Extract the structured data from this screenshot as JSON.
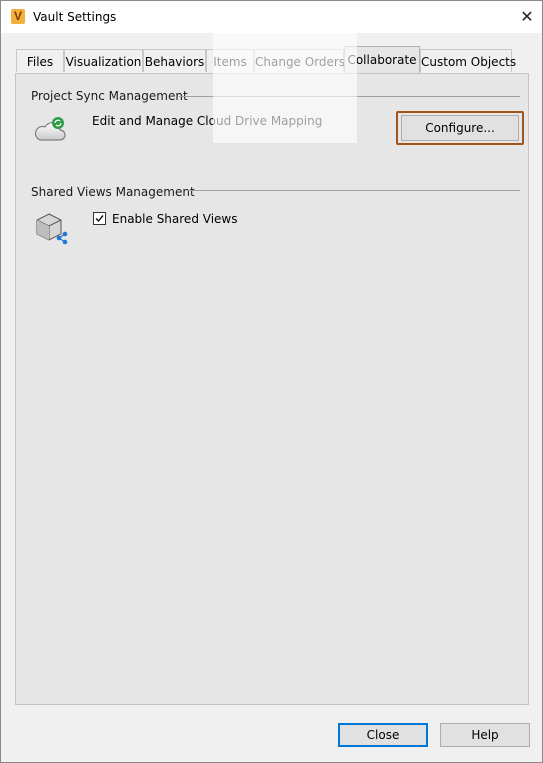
{
  "window": {
    "title": "Vault Settings",
    "app_icon_letter": "V"
  },
  "tabs": [
    {
      "label": "Files"
    },
    {
      "label": "Visualization"
    },
    {
      "label": "Behaviors"
    },
    {
      "label": "Items"
    },
    {
      "label": "Change Orders"
    },
    {
      "label": "Collaborate",
      "active": true
    },
    {
      "label": "Custom Objects"
    }
  ],
  "project_sync": {
    "group_label": "Project Sync Management",
    "icon": "cloud-sync-icon",
    "description": "Edit and Manage Cloud Drive Mapping",
    "configure_label": "Configure..."
  },
  "shared_views": {
    "group_label": "Shared Views Management",
    "icon": "shared-views-cube-icon",
    "checkbox_label": "Enable Shared Views",
    "checked": true
  },
  "footer": {
    "close_label": "Close",
    "help_label": "Help"
  },
  "colors": {
    "highlight_outline": "#a0541c",
    "default_button_border": "#0078d7",
    "app_icon": "#f1b13a"
  }
}
